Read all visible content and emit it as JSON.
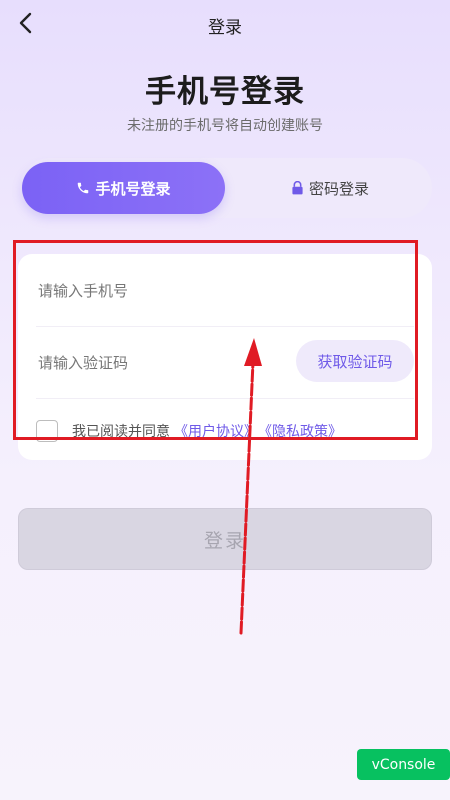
{
  "nav": {
    "title": "登录"
  },
  "header": {
    "title": "手机号登录",
    "subtitle": "未注册的手机号将自动创建账号"
  },
  "tabs": [
    {
      "label": "手机号登录",
      "icon": "phone-icon",
      "active": true
    },
    {
      "label": "密码登录",
      "icon": "lock-icon",
      "active": false
    }
  ],
  "form": {
    "phone_placeholder": "请输入手机号",
    "phone_value": "",
    "code_placeholder": "请输入验证码",
    "code_value": "",
    "get_code_label": "获取验证码",
    "agree_text": "我已阅读并同意",
    "user_agreement": "《用户协议》",
    "privacy_policy": "《隐私政策》"
  },
  "login_button": "登录",
  "vconsole_label": "vConsole",
  "colors": {
    "accent": "#7b62f5",
    "annotation": "#e01b24",
    "vconsole": "#07c160"
  }
}
